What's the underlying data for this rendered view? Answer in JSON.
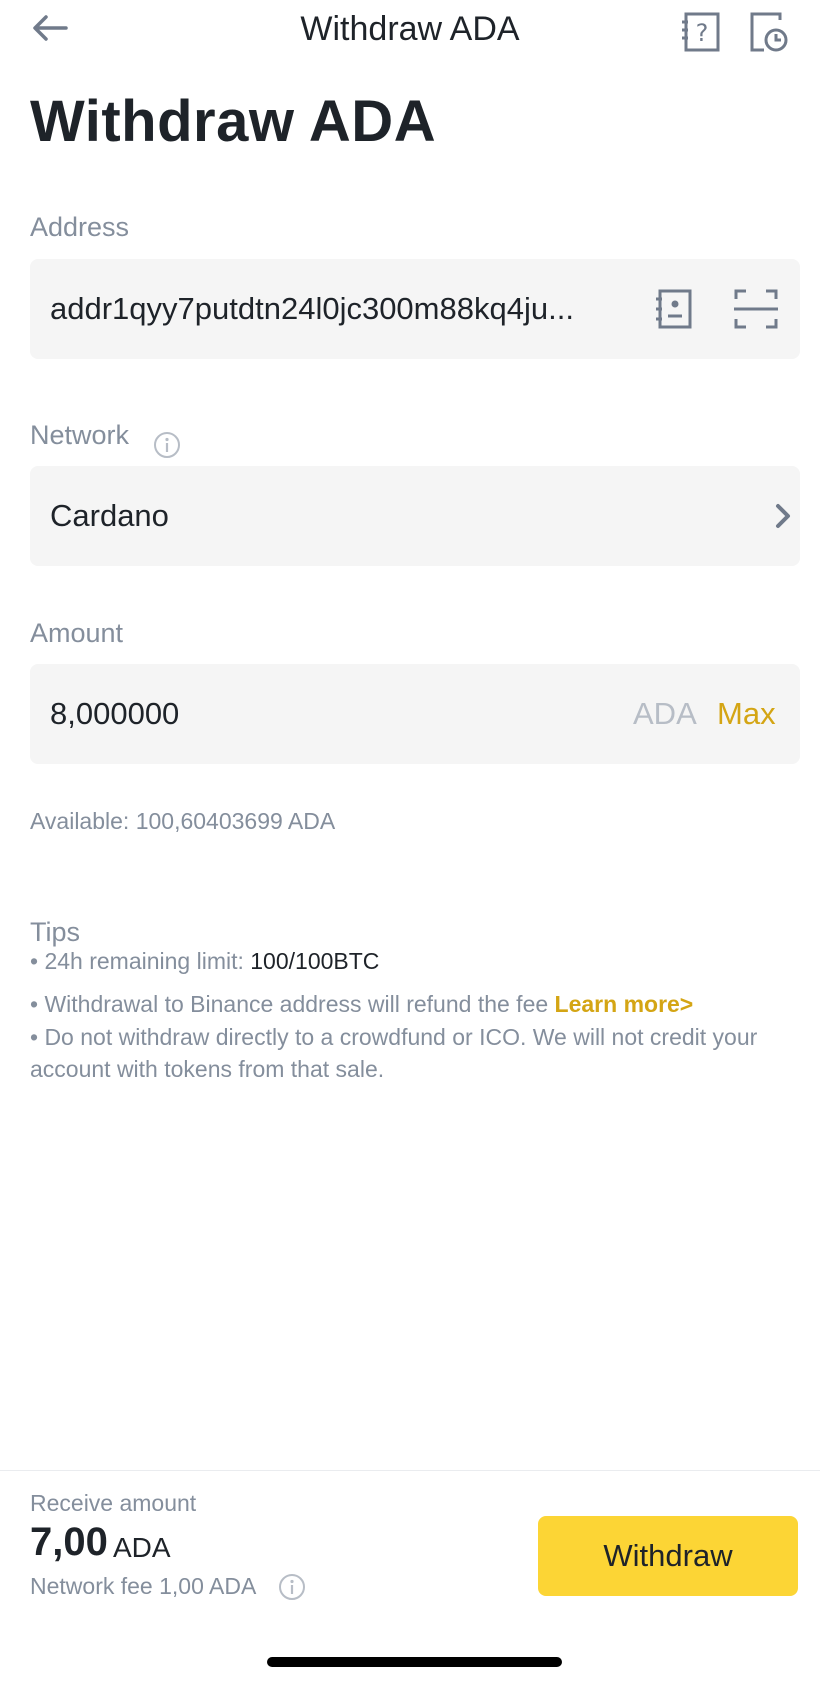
{
  "header": {
    "title": "Withdraw ADA",
    "back_icon": "arrow-left-icon",
    "help_icon": "help-document-icon",
    "history_icon": "history-document-icon"
  },
  "page_title": "Withdraw ADA",
  "address": {
    "label": "Address",
    "value": "addr1qyy7putdtn24l0jc300m88kq4ju...",
    "address_book_icon": "address-book-icon",
    "scan_icon": "scan-icon"
  },
  "network": {
    "label": "Network",
    "value": "Cardano",
    "info_icon": "info-icon",
    "chevron_icon": "chevron-right-icon"
  },
  "amount": {
    "label": "Amount",
    "value": "8,000000",
    "unit": "ADA",
    "max_label": "Max",
    "available_prefix": "Available:",
    "available_value": "100,60403699 ADA"
  },
  "tips": {
    "title": "Tips",
    "limit_prefix": "• 24h remaining limit:",
    "limit_value": "100/100BTC",
    "refund_text": "• Withdrawal to Binance address will refund the fee",
    "learn_more": "Learn more>",
    "warning_text": "• Do not withdraw directly to a crowdfund or ICO. We will not credit your account with tokens from that sale."
  },
  "footer": {
    "receive_label": "Receive amount",
    "receive_value": "7,00",
    "receive_unit": "ADA",
    "fee_text": "Network fee 1,00 ADA",
    "withdraw_label": "Withdraw"
  },
  "colors": {
    "accent_yellow": "#fcd535",
    "link_gold": "#d4a514",
    "text_primary": "#1e2329",
    "text_secondary": "#848e9c",
    "field_bg": "#f5f5f5"
  }
}
